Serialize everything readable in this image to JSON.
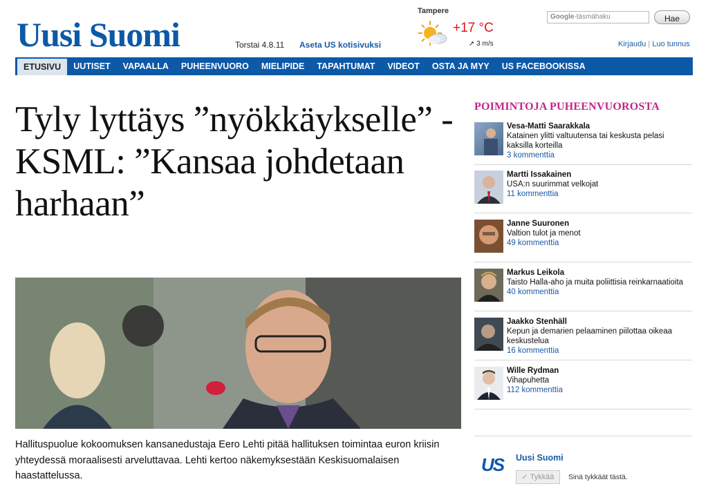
{
  "header": {
    "logo": "Uusi Suomi",
    "date": "Torstai 4.8.11",
    "set_home": "Aseta US kotisivuksi",
    "weather": {
      "city": "Tampere",
      "temp": "+17 °C",
      "wind": "3 m/s",
      "icon": "partly-sunny-icon"
    },
    "search": {
      "brand": "Google",
      "placeholder": "-täsmähaku",
      "button": "Hae"
    },
    "login": "Kirjaudu",
    "register": "Luo tunnus",
    "separator": "|"
  },
  "nav": {
    "items": [
      "ETUSIVU",
      "UUTISET",
      "VAPAALLA",
      "PUHEENVUORO",
      "MIELIPIDE",
      "TAPAHTUMAT",
      "VIDEOT",
      "OSTA JA MYY",
      "US FACEBOOKISSA"
    ],
    "active": "ETUSIVU"
  },
  "article": {
    "headline": "Tyly lyttäys ”nyökkäykselle” - KSML: ”Kansaa johdetaan harhaan”",
    "lead": "Hallituspuolue kokoomuksen kansanedustaja Eero Lehti pitää hallituksen toimintaa euron kriisin yhteydessä moraalisesti arveluttavaa. Lehti kertoo näkemyksestään Keskisuomalaisen haastattelussa."
  },
  "sidebar": {
    "heading": "POIMINTOJA PUHEENVUOROSTA",
    "items": [
      {
        "name": "Vesa-Matti Saarakkala",
        "title": "Katainen ylitti valtuutensa tai keskusta pelasi kaksilla korteilla",
        "comments": "3 kommenttia"
      },
      {
        "name": "Martti Issakainen",
        "title": "USA:n suurimmat velkojat",
        "comments": "11 kommenttia"
      },
      {
        "name": "Janne Suuronen",
        "title": "Valtion tulot ja menot",
        "comments": "49 kommenttia"
      },
      {
        "name": "Markus Leikola",
        "title": "Taisto Halla-aho ja muita poliittisia reinkarnaatioita",
        "comments": "40 kommenttia"
      },
      {
        "name": "Jaakko Stenhäll",
        "title": "Kepun ja demarien pelaaminen piilottaa oikeaa keskustelua",
        "comments": "16 kommenttia"
      },
      {
        "name": "Wille Rydman",
        "title": "Vihapuhetta",
        "comments": "112 kommenttia"
      }
    ]
  },
  "facebook": {
    "logo": "US",
    "page_name": "Uusi Suomi",
    "like_button": "✓ Tykkää",
    "like_text": "Sinä tykkäät tästä."
  }
}
